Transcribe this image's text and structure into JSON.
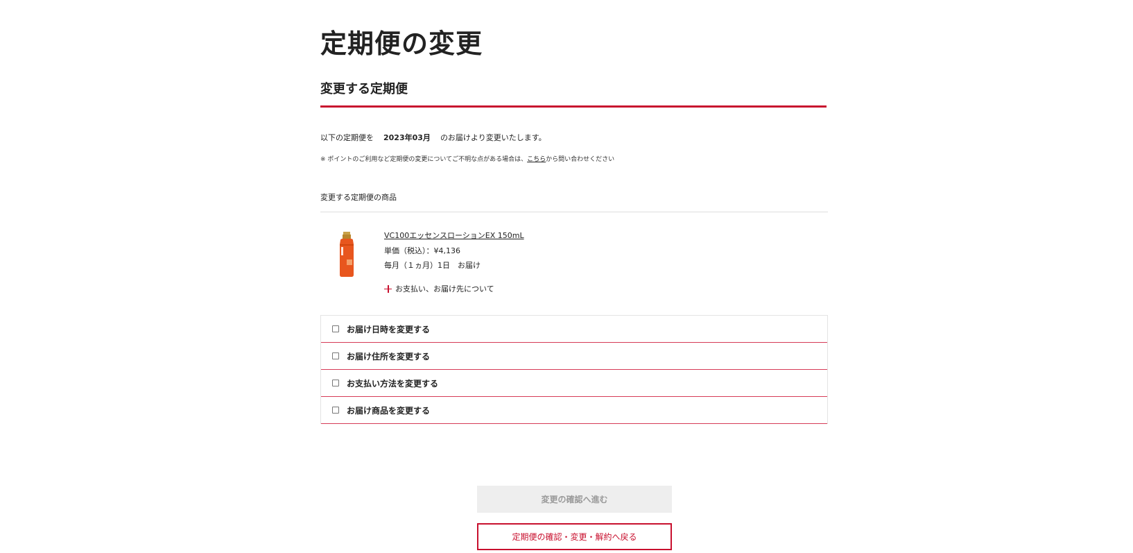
{
  "page": {
    "title": "定期便の変更"
  },
  "section": {
    "title": "変更する定期便"
  },
  "notice": {
    "prefix": "以下の定期便を",
    "date": "2023年03月",
    "suffix": "のお届けより変更いたします。"
  },
  "note": {
    "prefix": "※ ポイントのご利用など定期便の変更についてご不明な点がある場合は、",
    "link_text": "こちら",
    "suffix": "から問い合わせください"
  },
  "products": {
    "label": "変更する定期便の商品",
    "items": [
      {
        "name": "VC100エッセンスローションEX 150mL",
        "price": "単価（税込）：¥4,136",
        "schedule": "毎月（１ヵ月）1日　お届け",
        "toggle_label": "お支払い、お届け先について"
      }
    ]
  },
  "options": [
    {
      "label": "お届け日時を変更する"
    },
    {
      "label": "お届け住所を変更する"
    },
    {
      "label": "お支払い方法を変更する"
    },
    {
      "label": "お届け商品を変更する"
    }
  ],
  "buttons": {
    "confirm_label": "変更の確認へ進む",
    "back_label": "定期便の確認・変更・解約へ戻る"
  },
  "colors": {
    "accent": "#c8102e",
    "disabled_bg": "#eeeeee",
    "product_orange": "#e8561e"
  },
  "icons": {
    "expand": "plus-icon",
    "option_checkbox": "checkbox-icon"
  }
}
